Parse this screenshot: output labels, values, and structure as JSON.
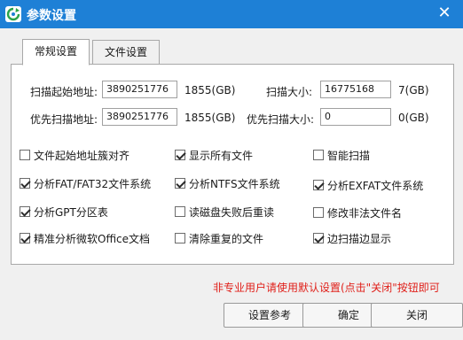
{
  "window": {
    "title": "参数设置",
    "close_glyph": "✕",
    "title_bar_color": "#1e80d6"
  },
  "tabs": [
    {
      "label": "常规设置",
      "active": true
    },
    {
      "label": "文件设置",
      "active": false
    }
  ],
  "fields": {
    "scan_start": {
      "label": "扫描起始地址:",
      "value": "3890251776",
      "size_text": "1855(GB)"
    },
    "scan_size": {
      "label": "扫描大小:",
      "value": "16775168",
      "size_text": "7(GB)"
    },
    "priority_start": {
      "label": "优先扫描地址:",
      "value": "3890251776",
      "size_text": "1855(GB)"
    },
    "priority_size": {
      "label": "优先扫描大小:",
      "value": "0",
      "size_text": "0(GB)"
    }
  },
  "options": [
    {
      "label": "文件起始地址簇对齐",
      "checked": false
    },
    {
      "label": "显示所有文件",
      "checked": true
    },
    {
      "label": "智能扫描",
      "checked": false
    },
    {
      "label": "分析FAT/FAT32文件系统",
      "checked": true
    },
    {
      "label": "分析NTFS文件系统",
      "checked": true
    },
    {
      "label": "分析EXFAT文件系统",
      "checked": true
    },
    {
      "label": "分析GPT分区表",
      "checked": true
    },
    {
      "label": "读磁盘失败后重读",
      "checked": false
    },
    {
      "label": "修改非法文件名",
      "checked": false
    },
    {
      "label": "精准分析微软Office文档",
      "checked": true
    },
    {
      "label": "清除重复的文件",
      "checked": false
    },
    {
      "label": "边扫描边显示",
      "checked": true
    }
  ],
  "hint": "非专业用户请使用默认设置(点击\"关闭\"按钮即可",
  "buttons": {
    "reset": "设置参考",
    "ok": "确定",
    "close": "关闭"
  },
  "icons": {
    "app": "refresh-app-icon"
  }
}
